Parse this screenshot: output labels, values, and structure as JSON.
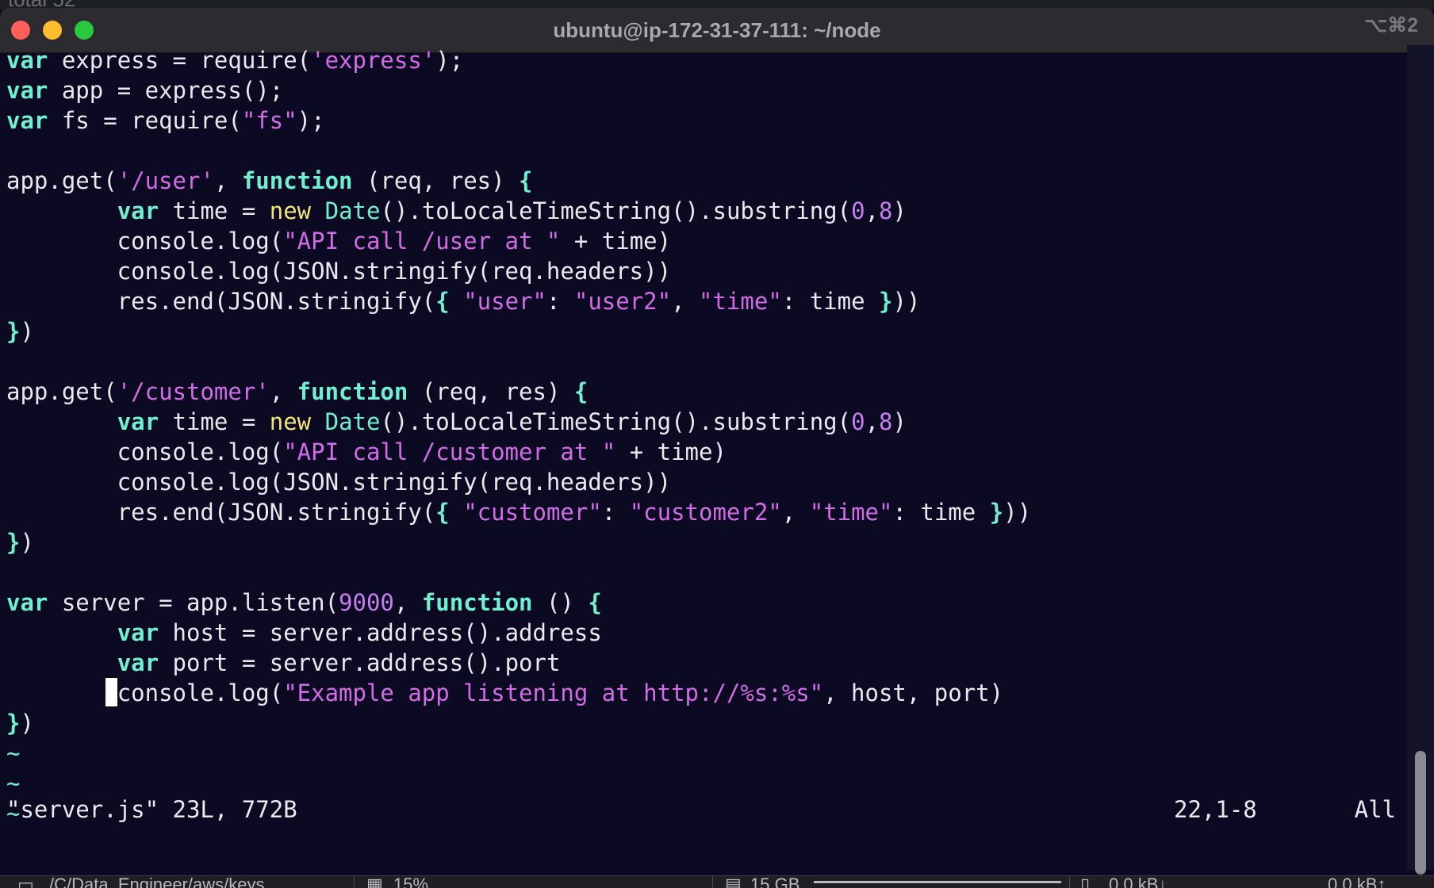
{
  "background_window": {
    "text": "total 52"
  },
  "titlebar": {
    "title": "ubuntu@ip-172-31-37-111: ~/node",
    "shortcut": "⌥⌘2"
  },
  "editor": {
    "lines": [
      [
        [
          "kw",
          "var"
        ],
        [
          "p",
          " express = require("
        ],
        [
          "str",
          "'express'"
        ],
        [
          "p",
          ");"
        ]
      ],
      [
        [
          "kw",
          "var"
        ],
        [
          "p",
          " app = express();"
        ]
      ],
      [
        [
          "kw",
          "var"
        ],
        [
          "p",
          " fs = require("
        ],
        [
          "str",
          "\"fs\""
        ],
        [
          "p",
          ");"
        ]
      ],
      [],
      [
        [
          "p",
          "app.get("
        ],
        [
          "str",
          "'/user'"
        ],
        [
          "p",
          ", "
        ],
        [
          "kw",
          "function"
        ],
        [
          "p",
          " (req, res) "
        ],
        [
          "brace",
          "{"
        ]
      ],
      [
        [
          "p",
          "        "
        ],
        [
          "kw",
          "var"
        ],
        [
          "p",
          " time = "
        ],
        [
          "newkw",
          "new"
        ],
        [
          "p",
          " "
        ],
        [
          "cls",
          "Date"
        ],
        [
          "p",
          "().toLocaleTimeString().substring("
        ],
        [
          "num",
          "0"
        ],
        [
          "p",
          ","
        ],
        [
          "num",
          "8"
        ],
        [
          "p",
          ")"
        ]
      ],
      [
        [
          "p",
          "        console.log("
        ],
        [
          "str",
          "\"API call /user at \""
        ],
        [
          "p",
          " + time)"
        ]
      ],
      [
        [
          "p",
          "        console.log(JSON.stringify(req.headers))"
        ]
      ],
      [
        [
          "p",
          "        res.end(JSON.stringify("
        ],
        [
          "brace",
          "{"
        ],
        [
          "p",
          " "
        ],
        [
          "str",
          "\"user\""
        ],
        [
          "p",
          ": "
        ],
        [
          "str",
          "\"user2\""
        ],
        [
          "p",
          ", "
        ],
        [
          "str",
          "\"time\""
        ],
        [
          "p",
          ": time "
        ],
        [
          "brace",
          "}"
        ],
        [
          "p",
          "))"
        ]
      ],
      [
        [
          "brace",
          "}"
        ],
        [
          "p",
          ")"
        ]
      ],
      [],
      [
        [
          "p",
          "app.get("
        ],
        [
          "str",
          "'/customer'"
        ],
        [
          "p",
          ", "
        ],
        [
          "kw",
          "function"
        ],
        [
          "p",
          " (req, res) "
        ],
        [
          "brace",
          "{"
        ]
      ],
      [
        [
          "p",
          "        "
        ],
        [
          "kw",
          "var"
        ],
        [
          "p",
          " time = "
        ],
        [
          "newkw",
          "new"
        ],
        [
          "p",
          " "
        ],
        [
          "cls",
          "Date"
        ],
        [
          "p",
          "().toLocaleTimeString().substring("
        ],
        [
          "num",
          "0"
        ],
        [
          "p",
          ","
        ],
        [
          "num",
          "8"
        ],
        [
          "p",
          ")"
        ]
      ],
      [
        [
          "p",
          "        console.log("
        ],
        [
          "str",
          "\"API call /customer at \""
        ],
        [
          "p",
          " + time)"
        ]
      ],
      [
        [
          "p",
          "        console.log(JSON.stringify(req.headers))"
        ]
      ],
      [
        [
          "p",
          "        res.end(JSON.stringify("
        ],
        [
          "brace",
          "{"
        ],
        [
          "p",
          " "
        ],
        [
          "str",
          "\"customer\""
        ],
        [
          "p",
          ": "
        ],
        [
          "str",
          "\"customer2\""
        ],
        [
          "p",
          ", "
        ],
        [
          "str",
          "\"time\""
        ],
        [
          "p",
          ": time "
        ],
        [
          "brace",
          "}"
        ],
        [
          "p",
          "))"
        ]
      ],
      [
        [
          "brace",
          "}"
        ],
        [
          "p",
          ")"
        ]
      ],
      [],
      [
        [
          "kw",
          "var"
        ],
        [
          "p",
          " server = app.listen("
        ],
        [
          "num",
          "9000"
        ],
        [
          "p",
          ", "
        ],
        [
          "kw",
          "function"
        ],
        [
          "p",
          " () "
        ],
        [
          "brace",
          "{"
        ]
      ],
      [
        [
          "p",
          "        "
        ],
        [
          "kw",
          "var"
        ],
        [
          "p",
          " host = server.address().address"
        ]
      ],
      [
        [
          "p",
          "        "
        ],
        [
          "kw",
          "var"
        ],
        [
          "p",
          " port = server.address().port"
        ]
      ],
      [
        [
          "p",
          "        "
        ],
        [
          "cursor",
          ""
        ],
        [
          "p",
          "console.log("
        ],
        [
          "str",
          "\"Example app listening at http://%s:%s\""
        ],
        [
          "p",
          ", host, port)"
        ]
      ],
      [
        [
          "brace",
          "}"
        ],
        [
          "p",
          ")"
        ]
      ],
      [
        [
          "tilde",
          "~"
        ]
      ],
      [
        [
          "tilde",
          "~"
        ]
      ],
      [
        [
          "tilde",
          "~"
        ]
      ]
    ]
  },
  "statusline": {
    "file_info": "\"server.js\" 23L, 772B",
    "position": "22,1-8",
    "scroll": "All"
  },
  "bottom_bar": {
    "path": "/C/Data_Engineer/aws/keys",
    "cpu": "15%",
    "memory": "15 GB",
    "net_down": "0.0 kB↓",
    "net_up": "0.0 kB↑"
  },
  "colors": {
    "keyword": "#6ff1d1",
    "string": "#d36be8",
    "number": "#c77cf0",
    "new_keyword": "#f2e57a",
    "background": "#0b0a22",
    "foreground": "#e9e9ee"
  }
}
